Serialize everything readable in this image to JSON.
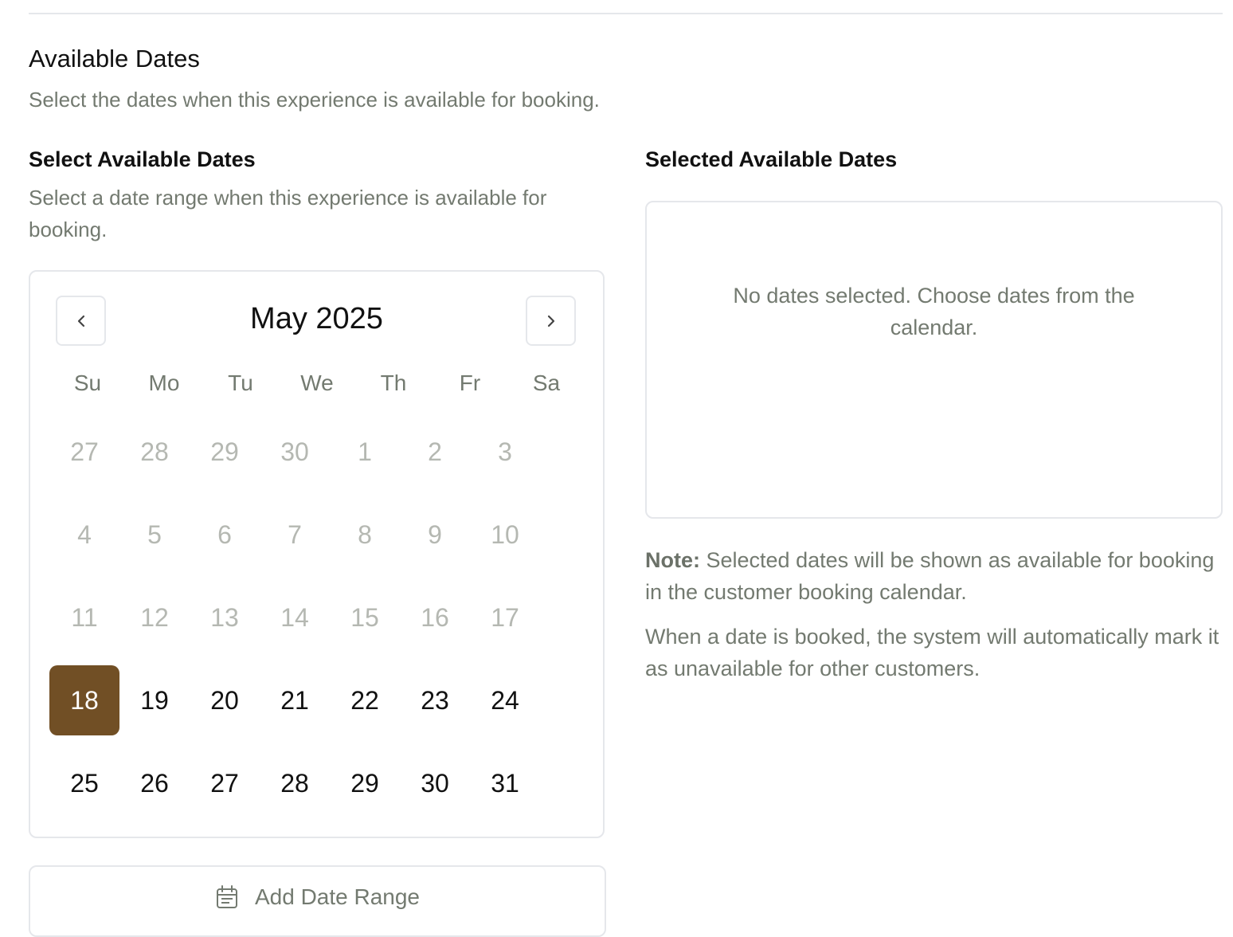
{
  "section": {
    "title": "Available Dates",
    "subtitle": "Select the dates when this experience is available for booking."
  },
  "picker": {
    "label": "Select Available Dates",
    "helper": "Select a date range when this experience is available for booking.",
    "month_label": "May 2025",
    "weekdays": [
      "Su",
      "Mo",
      "Tu",
      "We",
      "Th",
      "Fr",
      "Sa"
    ],
    "weeks": [
      [
        {
          "d": "27",
          "muted": true
        },
        {
          "d": "28",
          "muted": true
        },
        {
          "d": "29",
          "muted": true
        },
        {
          "d": "30",
          "muted": true
        },
        {
          "d": "1",
          "muted": true
        },
        {
          "d": "2",
          "muted": true
        },
        {
          "d": "3",
          "muted": true
        }
      ],
      [
        {
          "d": "4",
          "muted": true
        },
        {
          "d": "5",
          "muted": true
        },
        {
          "d": "6",
          "muted": true
        },
        {
          "d": "7",
          "muted": true
        },
        {
          "d": "8",
          "muted": true
        },
        {
          "d": "9",
          "muted": true
        },
        {
          "d": "10",
          "muted": true
        }
      ],
      [
        {
          "d": "11",
          "muted": true
        },
        {
          "d": "12",
          "muted": true
        },
        {
          "d": "13",
          "muted": true
        },
        {
          "d": "14",
          "muted": true
        },
        {
          "d": "15",
          "muted": true
        },
        {
          "d": "16",
          "muted": true
        },
        {
          "d": "17",
          "muted": true
        }
      ],
      [
        {
          "d": "18",
          "selected": true
        },
        {
          "d": "19"
        },
        {
          "d": "20"
        },
        {
          "d": "21"
        },
        {
          "d": "22"
        },
        {
          "d": "23"
        },
        {
          "d": "24"
        }
      ],
      [
        {
          "d": "25"
        },
        {
          "d": "26"
        },
        {
          "d": "27"
        },
        {
          "d": "28"
        },
        {
          "d": "29"
        },
        {
          "d": "30"
        },
        {
          "d": "31"
        }
      ]
    ],
    "add_range_label": "Add Date Range",
    "prev_icon": "chevron-left-icon",
    "next_icon": "chevron-right-icon",
    "calendar_icon": "calendar-icon"
  },
  "selected": {
    "label": "Selected Available Dates",
    "empty_text": "No dates selected. Choose dates from the calendar."
  },
  "notes": {
    "note_prefix": "Note:",
    "note_text": " Selected dates will be shown as available for booking in the customer booking calendar.",
    "booked_text": "When a date is booked, the system will automatically mark it as unavailable for other customers."
  },
  "colors": {
    "accent": "#714f25",
    "muted_text": "#737a70",
    "border": "#e5e7eb"
  }
}
